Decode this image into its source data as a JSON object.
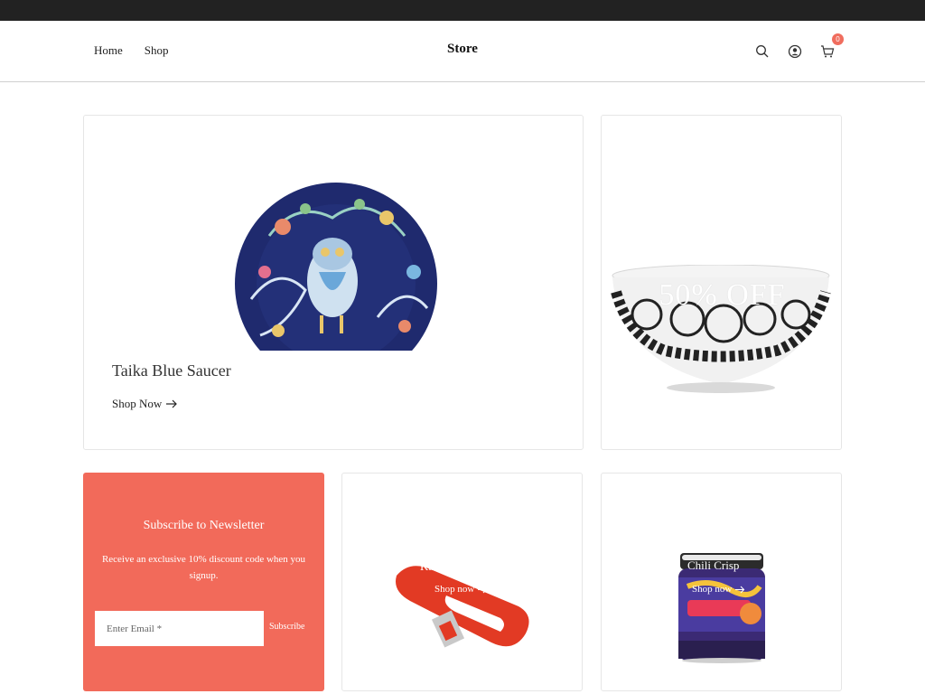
{
  "announcement": "",
  "nav": {
    "home": "Home",
    "shop": "Shop"
  },
  "brand": "Store",
  "header_icons": {
    "search": "search-icon",
    "account": "user-icon",
    "cart": "cart-icon",
    "cart_count": "0"
  },
  "hero": {
    "title": "Taika Blue Saucer",
    "link": "Shop Now"
  },
  "promo": {
    "text": "50% OFF"
  },
  "newsletter": {
    "title": "Subscribe to Newsletter",
    "description": "Receive an exclusive 10% discount code when you signup.",
    "email_placeholder": "Enter Email *",
    "button": "Subscribe"
  },
  "products": [
    {
      "title": "Kaikai",
      "link": "Shop now"
    },
    {
      "title": "Chili Crisp",
      "link": "Shop now"
    }
  ],
  "colors": {
    "accent": "#f26a5a",
    "topbar": "#222222"
  }
}
